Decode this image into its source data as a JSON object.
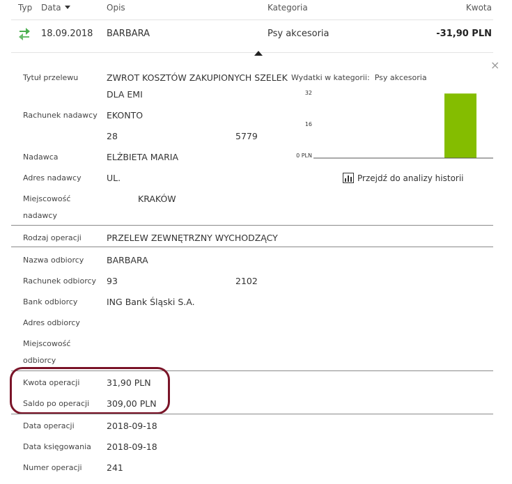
{
  "table": {
    "headers": {
      "typ": "Typ",
      "data": "Data",
      "opis": "Opis",
      "kategoria": "Kategoria",
      "kwota": "Kwota"
    },
    "row": {
      "date": "18.09.2018",
      "description": "BARBARA",
      "category": "Psy akcesoria",
      "amount": "-31,90 PLN",
      "type_icon": "transfer-arrows-icon"
    }
  },
  "details": {
    "tytul_label": "Tytuł przelewu",
    "tytul_line1": "ZWROT KOSZTÓW ZAKUPIONYCH SZELEK",
    "tytul_line2": "DLA EMI",
    "rachunek_nadawcy_label": "Rachunek nadawcy",
    "rachunek_nadawcy_line1": "EKONTO",
    "rachunek_nadawcy_part1": "28",
    "rachunek_nadawcy_part2": "5779",
    "nadawca_label": "Nadawca",
    "nadawca_value": "ELŻBIETA MARIA",
    "adres_nadawcy_label": "Adres nadawcy",
    "adres_nadawcy_value": "UL.",
    "miejscowosc_nadawcy_label_1": "Miejscowość",
    "miejscowosc_nadawcy_label_2": "nadawcy",
    "miejscowosc_nadawcy_value": "KRAKÓW",
    "rodzaj_label": "Rodzaj operacji",
    "rodzaj_value": "PRZELEW ZEWNĘTRZNY WYCHODZĄCY",
    "nazwa_odbiorcy_label": "Nazwa odbiorcy",
    "nazwa_odbiorcy_value": "BARBARA",
    "rachunek_odbiorcy_label": "Rachunek odbiorcy",
    "rachunek_odbiorcy_part1": "93",
    "rachunek_odbiorcy_part2": "2102",
    "bank_odbiorcy_label": "Bank odbiorcy",
    "bank_odbiorcy_value": "ING Bank Śląski S.A.",
    "adres_odbiorcy_label": "Adres odbiorcy",
    "miejscowosc_odbiorcy_label_1": "Miejscowość",
    "miejscowosc_odbiorcy_label_2": "odbiorcy",
    "kwota_label": "Kwota operacji",
    "kwota_value": "31,90 PLN",
    "saldo_label": "Saldo po operacji",
    "saldo_value": "309,00 PLN",
    "data_operacji_label": "Data operacji",
    "data_operacji_value": "2018-09-18",
    "data_ksiegowania_label": "Data księgowania",
    "data_ksiegowania_value": "2018-09-18",
    "numer_label": "Numer operacji",
    "numer_value": "241"
  },
  "chart_panel": {
    "title_prefix": "Wydatki w kategorii:",
    "title_category": "Psy akcesoria",
    "link_label": "Przejdź do analizy historii",
    "link_icon": "bar-chart-icon",
    "close_icon": "close-icon",
    "close_glyph": "×"
  },
  "colors": {
    "bar": "#84bd00",
    "transfer_icon": "#4caf50",
    "highlight_ring": "#7a1428"
  },
  "chart_data": {
    "type": "bar",
    "categories": [
      ""
    ],
    "values": [
      31.9
    ],
    "ylim": [
      0,
      32
    ],
    "yticks": [
      "0 PLN",
      "16",
      "32"
    ],
    "bar_color": "#84bd00",
    "grid": false,
    "legend": "none"
  }
}
